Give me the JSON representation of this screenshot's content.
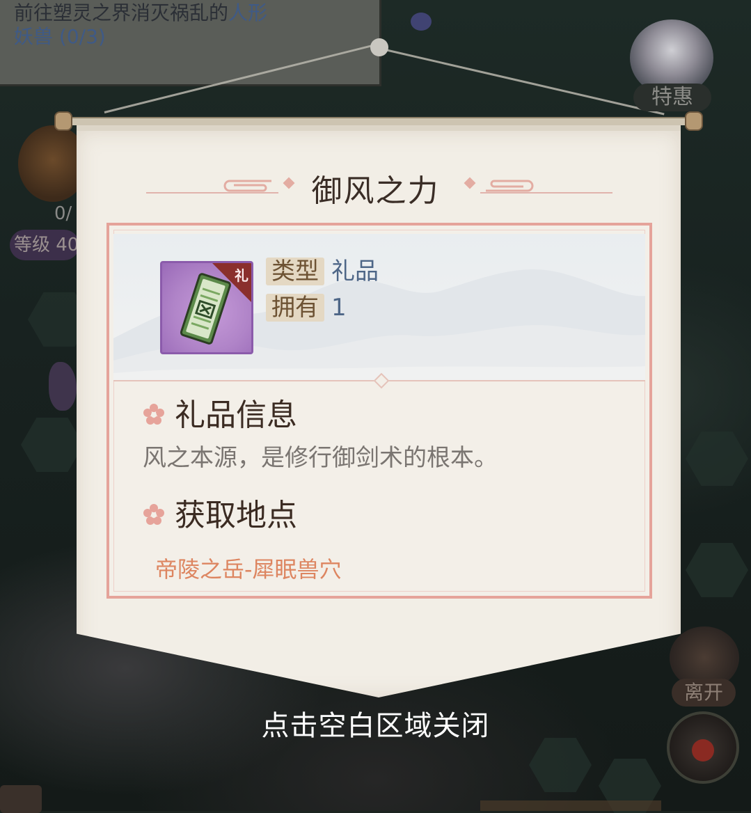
{
  "background": {
    "quest": {
      "line1_prefix": "前往塑灵之界消灭祸乱的",
      "line1_highlight": "人形",
      "line2": "妖兽 (0/3)"
    },
    "left_panel": {
      "count": "0/",
      "level_label": "等级 40"
    },
    "right_panel": {
      "special_offer_label": "特惠",
      "leave_label": "离开"
    }
  },
  "dialog": {
    "title": "御风之力",
    "item": {
      "badge_char": "礼",
      "type_key": "类型",
      "type_value": "礼品",
      "owned_key": "拥有",
      "owned_value": "1"
    },
    "info_section": {
      "heading": "礼品信息",
      "description": "风之本源，是修行御剑术的根本。"
    },
    "source_section": {
      "heading": "获取地点",
      "location": "帝陵之岳-犀眠兽穴"
    }
  },
  "close_hint": "点击空白区域关闭",
  "colors": {
    "accent_border": "#e5a39a",
    "title_text": "#3a2d26",
    "value_text": "#4e6687",
    "location_text": "#dd8560",
    "item_frame_purple": "#8b5bab"
  }
}
